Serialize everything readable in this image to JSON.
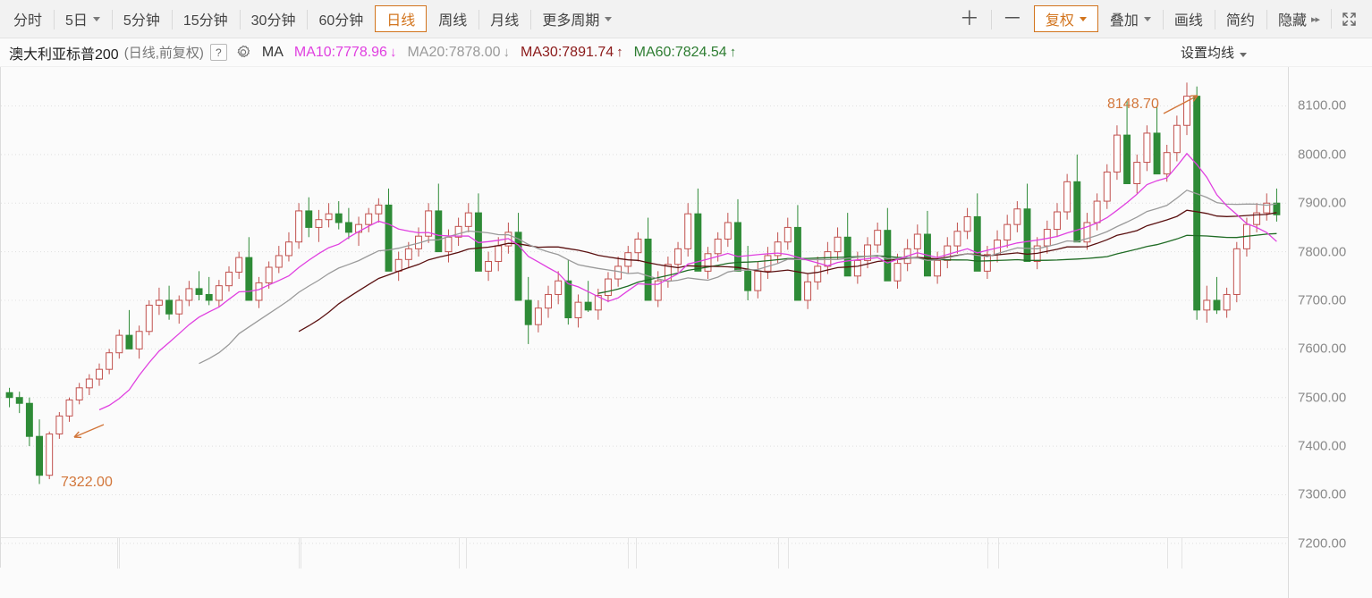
{
  "toolbar": {
    "left_buttons": [
      {
        "label": "分时",
        "name": "timeframe-intraday",
        "active": false,
        "caret": false
      },
      {
        "label": "5日",
        "name": "timeframe-5day",
        "active": false,
        "caret": true
      },
      {
        "label": "5分钟",
        "name": "timeframe-5min",
        "active": false,
        "caret": false
      },
      {
        "label": "15分钟",
        "name": "timeframe-15min",
        "active": false,
        "caret": false
      },
      {
        "label": "30分钟",
        "name": "timeframe-30min",
        "active": false,
        "caret": false
      },
      {
        "label": "60分钟",
        "name": "timeframe-60min",
        "active": false,
        "caret": false
      },
      {
        "label": "日线",
        "name": "timeframe-daily",
        "active": true,
        "caret": false
      },
      {
        "label": "周线",
        "name": "timeframe-weekly",
        "active": false,
        "caret": false
      },
      {
        "label": "月线",
        "name": "timeframe-monthly",
        "active": false,
        "caret": false
      },
      {
        "label": "更多周期",
        "name": "timeframe-more",
        "active": false,
        "caret": true
      }
    ],
    "right_buttons": [
      {
        "label": "＋",
        "name": "zoom-in-button",
        "active": false,
        "caret": false,
        "glyph": true
      },
      {
        "label": "－",
        "name": "zoom-out-button",
        "active": false,
        "caret": false,
        "glyph": true
      },
      {
        "label": "复权",
        "name": "adjust-price-button",
        "active": true,
        "caret": true
      },
      {
        "label": "叠加",
        "name": "overlay-button",
        "active": false,
        "caret": true
      },
      {
        "label": "画线",
        "name": "draw-line-button",
        "active": false,
        "caret": false
      },
      {
        "label": "简约",
        "name": "simple-view-button",
        "active": false,
        "caret": false
      },
      {
        "label": "隐藏",
        "name": "hide-panel-button",
        "active": false,
        "caret": false,
        "dblarrow": "▸▸"
      }
    ],
    "fullscreen_icon": "fullscreen-icon"
  },
  "infobar": {
    "symbol_name": "澳大利亚标普200",
    "period_text": "(日线,前复权)",
    "help_label": "?",
    "gear_icon": "gear-icon",
    "ma_label": "MA",
    "ma_items": [
      {
        "text": "MA10:7778.96",
        "arrow": "↓",
        "color": "#e040e0",
        "name": "ma10-value"
      },
      {
        "text": "MA20:7878.00",
        "arrow": "↓",
        "color": "#9a9a9a",
        "name": "ma20-value"
      },
      {
        "text": "MA30:7891.74",
        "arrow": "↑",
        "color": "#8b1a1a",
        "name": "ma30-value"
      },
      {
        "text": "MA60:7824.54",
        "arrow": "↑",
        "color": "#2e7d32",
        "name": "ma60-value"
      }
    ],
    "settings_label": "设置均线"
  },
  "chart_data": {
    "type": "line",
    "chart_kind": "candlestick",
    "title": "澳大利亚标普200 (日线,前复权)",
    "xlabel": "",
    "ylabel": "",
    "ylim": [
      7150,
      8180
    ],
    "grid": true,
    "yticks": [
      8100,
      8000,
      7900,
      7800,
      7700,
      7600,
      7500,
      7400,
      7300,
      7200
    ],
    "ytick_labels": [
      "8100.00",
      "8000.00",
      "7900.00",
      "7800.00",
      "7700.00",
      "7600.00",
      "7500.00",
      "7400.00",
      "7300.00",
      "7200.00"
    ],
    "annotations": [
      {
        "text": "8148.70",
        "name": "high-annotation",
        "type": "high",
        "value": 8148.7,
        "x_index": 117,
        "color": "#d2763a"
      },
      {
        "text": "7322.00",
        "name": "low-annotation",
        "type": "low",
        "value": 7322.0,
        "x_index": 3,
        "color": "#d2763a"
      }
    ],
    "colors": {
      "up": "#c0504d",
      "up_fill": "#ffffff",
      "down": "#2e8b37",
      "ma10": "#e040e0",
      "ma20": "#9a9a9a",
      "ma30": "#5a1010",
      "ma60": "#1f6b24",
      "grid": "#e0e0e0",
      "axis": "#dcdcdc"
    },
    "legend_position": "top",
    "x_separator_indices": [
      11,
      29,
      45,
      62,
      77,
      98,
      116
    ],
    "ohlc": [
      [
        7510,
        7520,
        7480,
        7500
      ],
      [
        7500,
        7512,
        7468,
        7488
      ],
      [
        7488,
        7500,
        7400,
        7420
      ],
      [
        7420,
        7455,
        7322,
        7340
      ],
      [
        7340,
        7430,
        7332,
        7425
      ],
      [
        7425,
        7470,
        7415,
        7462
      ],
      [
        7462,
        7500,
        7450,
        7495
      ],
      [
        7495,
        7530,
        7486,
        7520
      ],
      [
        7520,
        7548,
        7505,
        7538
      ],
      [
        7538,
        7570,
        7524,
        7558
      ],
      [
        7558,
        7600,
        7548,
        7592
      ],
      [
        7592,
        7640,
        7580,
        7628
      ],
      [
        7628,
        7680,
        7612,
        7600
      ],
      [
        7600,
        7648,
        7580,
        7636
      ],
      [
        7636,
        7700,
        7628,
        7690
      ],
      [
        7690,
        7726,
        7670,
        7700
      ],
      [
        7700,
        7730,
        7660,
        7672
      ],
      [
        7672,
        7710,
        7652,
        7700
      ],
      [
        7700,
        7740,
        7688,
        7724
      ],
      [
        7724,
        7760,
        7700,
        7712
      ],
      [
        7712,
        7748,
        7690,
        7700
      ],
      [
        7700,
        7742,
        7686,
        7730
      ],
      [
        7730,
        7770,
        7718,
        7758
      ],
      [
        7758,
        7800,
        7744,
        7788
      ],
      [
        7788,
        7830,
        7774,
        7700
      ],
      [
        7700,
        7748,
        7684,
        7736
      ],
      [
        7736,
        7780,
        7724,
        7768
      ],
      [
        7768,
        7812,
        7756,
        7792
      ],
      [
        7792,
        7840,
        7780,
        7820
      ],
      [
        7820,
        7900,
        7806,
        7884
      ],
      [
        7884,
        7912,
        7830,
        7850
      ],
      [
        7850,
        7886,
        7820,
        7866
      ],
      [
        7866,
        7900,
        7850,
        7878
      ],
      [
        7878,
        7904,
        7846,
        7860
      ],
      [
        7860,
        7890,
        7826,
        7840
      ],
      [
        7840,
        7872,
        7812,
        7856
      ],
      [
        7856,
        7890,
        7840,
        7878
      ],
      [
        7878,
        7910,
        7860,
        7896
      ],
      [
        7896,
        7930,
        7876,
        7760
      ],
      [
        7760,
        7800,
        7740,
        7784
      ],
      [
        7784,
        7820,
        7768,
        7806
      ],
      [
        7806,
        7850,
        7790,
        7832
      ],
      [
        7832,
        7900,
        7818,
        7884
      ],
      [
        7884,
        7940,
        7870,
        7800
      ],
      [
        7800,
        7846,
        7778,
        7830
      ],
      [
        7830,
        7870,
        7812,
        7852
      ],
      [
        7852,
        7900,
        7840,
        7880
      ],
      [
        7880,
        7920,
        7846,
        7760
      ],
      [
        7760,
        7800,
        7740,
        7780
      ],
      [
        7780,
        7830,
        7760,
        7812
      ],
      [
        7812,
        7860,
        7796,
        7840
      ],
      [
        7840,
        7880,
        7822,
        7700
      ],
      [
        7700,
        7748,
        7610,
        7650
      ],
      [
        7650,
        7700,
        7634,
        7684
      ],
      [
        7684,
        7730,
        7664,
        7712
      ],
      [
        7712,
        7760,
        7692,
        7740
      ],
      [
        7740,
        7784,
        7650,
        7664
      ],
      [
        7664,
        7712,
        7644,
        7696
      ],
      [
        7696,
        7740,
        7676,
        7680
      ],
      [
        7680,
        7724,
        7660,
        7710
      ],
      [
        7710,
        7758,
        7696,
        7744
      ],
      [
        7744,
        7790,
        7728,
        7770
      ],
      [
        7770,
        7812,
        7756,
        7798
      ],
      [
        7798,
        7840,
        7780,
        7826
      ],
      [
        7826,
        7870,
        7810,
        7700
      ],
      [
        7700,
        7760,
        7686,
        7740
      ],
      [
        7740,
        7790,
        7726,
        7774
      ],
      [
        7774,
        7820,
        7758,
        7806
      ],
      [
        7806,
        7900,
        7790,
        7878
      ],
      [
        7878,
        7930,
        7862,
        7760
      ],
      [
        7760,
        7810,
        7744,
        7796
      ],
      [
        7796,
        7840,
        7780,
        7826
      ],
      [
        7826,
        7880,
        7810,
        7860
      ],
      [
        7860,
        7908,
        7844,
        7760
      ],
      [
        7760,
        7812,
        7700,
        7720
      ],
      [
        7720,
        7780,
        7704,
        7760
      ],
      [
        7760,
        7810,
        7744,
        7792
      ],
      [
        7792,
        7840,
        7776,
        7820
      ],
      [
        7820,
        7870,
        7804,
        7850
      ],
      [
        7850,
        7896,
        7832,
        7700
      ],
      [
        7700,
        7756,
        7682,
        7738
      ],
      [
        7738,
        7790,
        7722,
        7770
      ],
      [
        7770,
        7820,
        7754,
        7800
      ],
      [
        7800,
        7850,
        7784,
        7830
      ],
      [
        7830,
        7880,
        7814,
        7750
      ],
      [
        7750,
        7800,
        7734,
        7782
      ],
      [
        7782,
        7830,
        7766,
        7814
      ],
      [
        7814,
        7860,
        7798,
        7844
      ],
      [
        7844,
        7890,
        7828,
        7740
      ],
      [
        7740,
        7796,
        7724,
        7776
      ],
      [
        7776,
        7826,
        7760,
        7806
      ],
      [
        7806,
        7856,
        7790,
        7836
      ],
      [
        7836,
        7884,
        7820,
        7750
      ],
      [
        7750,
        7800,
        7734,
        7782
      ],
      [
        7782,
        7830,
        7766,
        7812
      ],
      [
        7812,
        7860,
        7796,
        7842
      ],
      [
        7842,
        7890,
        7826,
        7872
      ],
      [
        7872,
        7920,
        7856,
        7760
      ],
      [
        7760,
        7812,
        7744,
        7794
      ],
      [
        7794,
        7844,
        7778,
        7824
      ],
      [
        7824,
        7876,
        7808,
        7856
      ],
      [
        7856,
        7904,
        7840,
        7888
      ],
      [
        7888,
        7940,
        7872,
        7780
      ],
      [
        7780,
        7830,
        7764,
        7812
      ],
      [
        7812,
        7864,
        7796,
        7846
      ],
      [
        7846,
        7900,
        7830,
        7882
      ],
      [
        7882,
        7960,
        7866,
        7944
      ],
      [
        7944,
        8000,
        7928,
        7820
      ],
      [
        7820,
        7880,
        7804,
        7860
      ],
      [
        7860,
        7920,
        7844,
        7904
      ],
      [
        7904,
        7980,
        7888,
        7964
      ],
      [
        7964,
        8060,
        7948,
        8040
      ],
      [
        8040,
        8110,
        8020,
        7940
      ],
      [
        7940,
        8000,
        7920,
        7984
      ],
      [
        7984,
        8060,
        7966,
        8044
      ],
      [
        8044,
        8100,
        8026,
        7960
      ],
      [
        7960,
        8020,
        7944,
        8004
      ],
      [
        8004,
        8080,
        7986,
        8060
      ],
      [
        8060,
        8148,
        8040,
        8120
      ],
      [
        8120,
        8140,
        7660,
        7680
      ],
      [
        7680,
        7730,
        7654,
        7700
      ],
      [
        7700,
        7748,
        7672,
        7680
      ],
      [
        7680,
        7726,
        7664,
        7712
      ],
      [
        7712,
        7820,
        7696,
        7806
      ],
      [
        7806,
        7870,
        7790,
        7856
      ],
      [
        7856,
        7900,
        7840,
        7880
      ],
      [
        7880,
        7920,
        7864,
        7900
      ],
      [
        7900,
        7930,
        7862,
        7876
      ]
    ],
    "ma_series": {
      "MA10": {
        "name": "MA10",
        "current": 7778.96,
        "trend": "down",
        "color": "#e040e0"
      },
      "MA20": {
        "name": "MA20",
        "current": 7878.0,
        "trend": "down",
        "color": "#9a9a9a"
      },
      "MA30": {
        "name": "MA30",
        "current": 7891.74,
        "trend": "up",
        "color": "#5a1010"
      },
      "MA60": {
        "name": "MA60",
        "current": 7824.54,
        "trend": "up",
        "color": "#1f6b24"
      }
    }
  }
}
